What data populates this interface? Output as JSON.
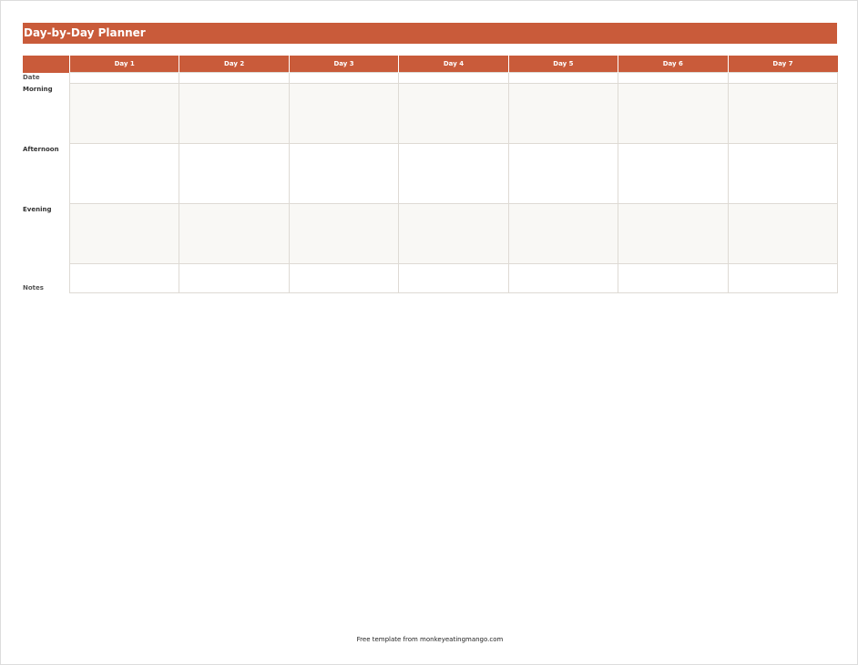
{
  "title": "Day-by-Day Planner",
  "days": [
    "Day 1",
    "Day 2",
    "Day 3",
    "Day 4",
    "Day 5",
    "Day 6",
    "Day 7"
  ],
  "rows": {
    "date": "Date",
    "morning": "Morning",
    "afternoon": "Afternoon",
    "evening": "Evening",
    "notes": "Notes"
  },
  "footer": "Free template from monkeyeatingmango.com",
  "colors": {
    "accent": "#c95b3a",
    "shade": "#f9f8f5",
    "grid": "#dedad4"
  }
}
